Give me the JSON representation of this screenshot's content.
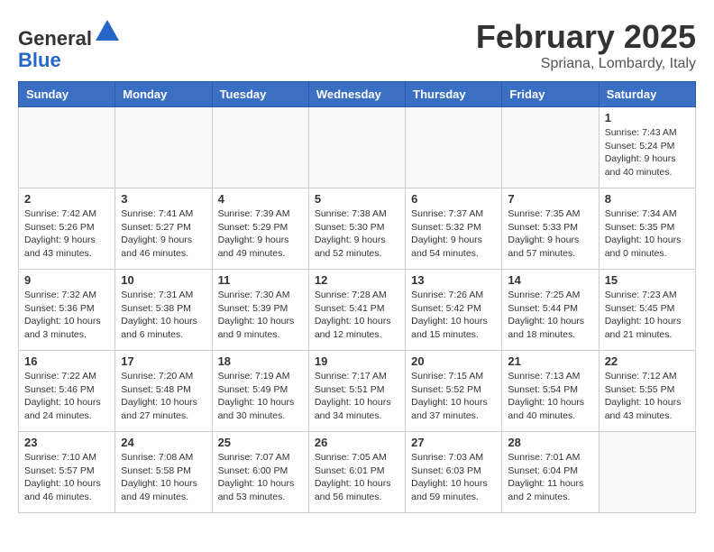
{
  "header": {
    "logo_line1": "General",
    "logo_line2": "Blue",
    "month_title": "February 2025",
    "location": "Spriana, Lombardy, Italy"
  },
  "weekdays": [
    "Sunday",
    "Monday",
    "Tuesday",
    "Wednesday",
    "Thursday",
    "Friday",
    "Saturday"
  ],
  "weeks": [
    [
      {
        "day": "",
        "info": ""
      },
      {
        "day": "",
        "info": ""
      },
      {
        "day": "",
        "info": ""
      },
      {
        "day": "",
        "info": ""
      },
      {
        "day": "",
        "info": ""
      },
      {
        "day": "",
        "info": ""
      },
      {
        "day": "1",
        "info": "Sunrise: 7:43 AM\nSunset: 5:24 PM\nDaylight: 9 hours and 40 minutes."
      }
    ],
    [
      {
        "day": "2",
        "info": "Sunrise: 7:42 AM\nSunset: 5:26 PM\nDaylight: 9 hours and 43 minutes."
      },
      {
        "day": "3",
        "info": "Sunrise: 7:41 AM\nSunset: 5:27 PM\nDaylight: 9 hours and 46 minutes."
      },
      {
        "day": "4",
        "info": "Sunrise: 7:39 AM\nSunset: 5:29 PM\nDaylight: 9 hours and 49 minutes."
      },
      {
        "day": "5",
        "info": "Sunrise: 7:38 AM\nSunset: 5:30 PM\nDaylight: 9 hours and 52 minutes."
      },
      {
        "day": "6",
        "info": "Sunrise: 7:37 AM\nSunset: 5:32 PM\nDaylight: 9 hours and 54 minutes."
      },
      {
        "day": "7",
        "info": "Sunrise: 7:35 AM\nSunset: 5:33 PM\nDaylight: 9 hours and 57 minutes."
      },
      {
        "day": "8",
        "info": "Sunrise: 7:34 AM\nSunset: 5:35 PM\nDaylight: 10 hours and 0 minutes."
      }
    ],
    [
      {
        "day": "9",
        "info": "Sunrise: 7:32 AM\nSunset: 5:36 PM\nDaylight: 10 hours and 3 minutes."
      },
      {
        "day": "10",
        "info": "Sunrise: 7:31 AM\nSunset: 5:38 PM\nDaylight: 10 hours and 6 minutes."
      },
      {
        "day": "11",
        "info": "Sunrise: 7:30 AM\nSunset: 5:39 PM\nDaylight: 10 hours and 9 minutes."
      },
      {
        "day": "12",
        "info": "Sunrise: 7:28 AM\nSunset: 5:41 PM\nDaylight: 10 hours and 12 minutes."
      },
      {
        "day": "13",
        "info": "Sunrise: 7:26 AM\nSunset: 5:42 PM\nDaylight: 10 hours and 15 minutes."
      },
      {
        "day": "14",
        "info": "Sunrise: 7:25 AM\nSunset: 5:44 PM\nDaylight: 10 hours and 18 minutes."
      },
      {
        "day": "15",
        "info": "Sunrise: 7:23 AM\nSunset: 5:45 PM\nDaylight: 10 hours and 21 minutes."
      }
    ],
    [
      {
        "day": "16",
        "info": "Sunrise: 7:22 AM\nSunset: 5:46 PM\nDaylight: 10 hours and 24 minutes."
      },
      {
        "day": "17",
        "info": "Sunrise: 7:20 AM\nSunset: 5:48 PM\nDaylight: 10 hours and 27 minutes."
      },
      {
        "day": "18",
        "info": "Sunrise: 7:19 AM\nSunset: 5:49 PM\nDaylight: 10 hours and 30 minutes."
      },
      {
        "day": "19",
        "info": "Sunrise: 7:17 AM\nSunset: 5:51 PM\nDaylight: 10 hours and 34 minutes."
      },
      {
        "day": "20",
        "info": "Sunrise: 7:15 AM\nSunset: 5:52 PM\nDaylight: 10 hours and 37 minutes."
      },
      {
        "day": "21",
        "info": "Sunrise: 7:13 AM\nSunset: 5:54 PM\nDaylight: 10 hours and 40 minutes."
      },
      {
        "day": "22",
        "info": "Sunrise: 7:12 AM\nSunset: 5:55 PM\nDaylight: 10 hours and 43 minutes."
      }
    ],
    [
      {
        "day": "23",
        "info": "Sunrise: 7:10 AM\nSunset: 5:57 PM\nDaylight: 10 hours and 46 minutes."
      },
      {
        "day": "24",
        "info": "Sunrise: 7:08 AM\nSunset: 5:58 PM\nDaylight: 10 hours and 49 minutes."
      },
      {
        "day": "25",
        "info": "Sunrise: 7:07 AM\nSunset: 6:00 PM\nDaylight: 10 hours and 53 minutes."
      },
      {
        "day": "26",
        "info": "Sunrise: 7:05 AM\nSunset: 6:01 PM\nDaylight: 10 hours and 56 minutes."
      },
      {
        "day": "27",
        "info": "Sunrise: 7:03 AM\nSunset: 6:03 PM\nDaylight: 10 hours and 59 minutes."
      },
      {
        "day": "28",
        "info": "Sunrise: 7:01 AM\nSunset: 6:04 PM\nDaylight: 11 hours and 2 minutes."
      },
      {
        "day": "",
        "info": ""
      }
    ]
  ]
}
